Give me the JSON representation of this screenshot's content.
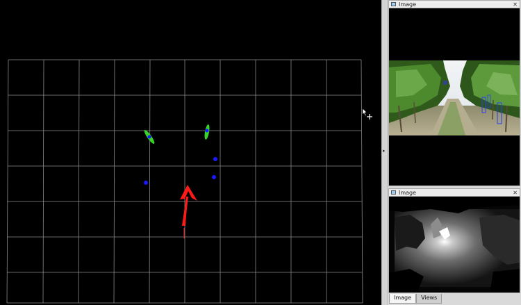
{
  "main_view": {
    "background": "#000000",
    "grid_color": "#8a8a8a",
    "grid_cols": 10,
    "grid_rows": 7,
    "arrow_color": "#ff1a1a",
    "marker_colors": {
      "point": "#1a1aff",
      "ellipse": "#39d12b"
    }
  },
  "docks": [
    {
      "title": "Image",
      "close_label": "✕",
      "content": "vineyard-camera-image"
    },
    {
      "title": "Image",
      "close_label": "✕",
      "content": "depth-image"
    }
  ],
  "tabs": [
    {
      "label": "Image",
      "active": true
    },
    {
      "label": "Views",
      "active": false
    }
  ],
  "splitter": {
    "arrow_glyph": "▸"
  },
  "icons": {
    "cursor": "move-cursor-icon",
    "dock": "image-panel-icon"
  }
}
